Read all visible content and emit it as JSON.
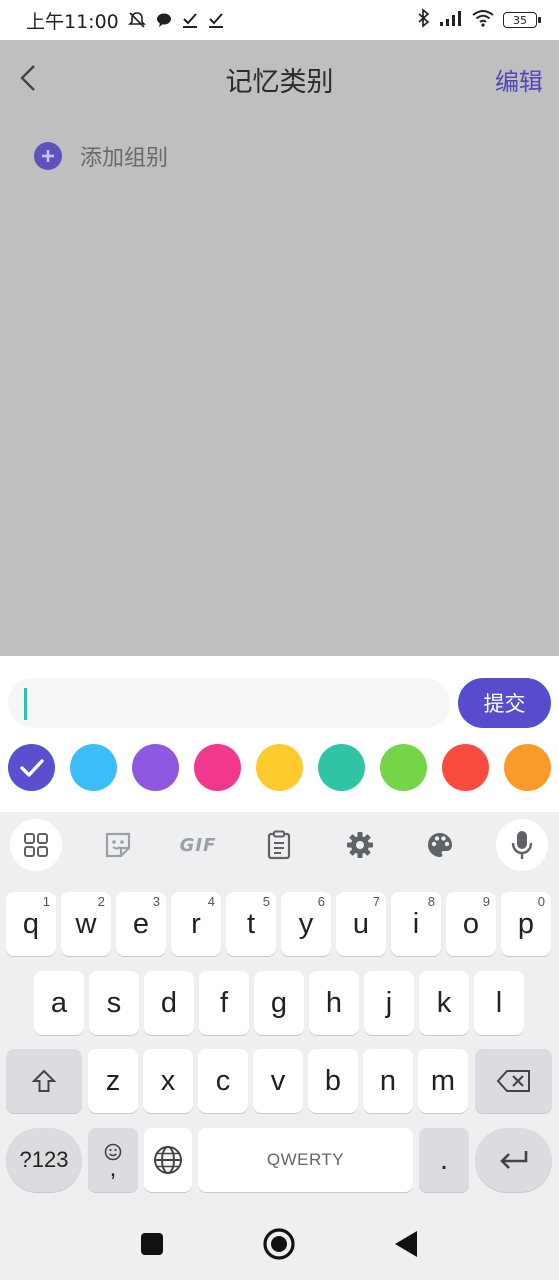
{
  "status_bar": {
    "time": "上午11:00",
    "battery": "35",
    "icons": [
      "mute-bell-icon",
      "chat-bubble-icon",
      "check-icon",
      "check-icon",
      "bluetooth-icon",
      "signal-icon",
      "wifi-icon",
      "battery-icon"
    ]
  },
  "header": {
    "back_icon": "chevron-left-icon",
    "title": "记忆类别",
    "edit_label": "编辑"
  },
  "content": {
    "add_group_icon": "plus-circle-icon",
    "add_group_label": "添加组别"
  },
  "input_panel": {
    "value": "",
    "submit_label": "提交",
    "selected_color": "#5a4fcf",
    "colors": [
      "#5a4fcf",
      "#3cbcf9",
      "#8f58e0",
      "#f2388c",
      "#fdcc2c",
      "#2fc4a4",
      "#75d548",
      "#f94b3f",
      "#f99a2a"
    ]
  },
  "keyboard": {
    "toolbar": [
      "apps-grid-icon",
      "sticker-icon",
      "GIF",
      "clipboard-icon",
      "gear-icon",
      "palette-icon",
      "microphone-icon"
    ],
    "row1": [
      {
        "k": "q",
        "h": "1"
      },
      {
        "k": "w",
        "h": "2"
      },
      {
        "k": "e",
        "h": "3"
      },
      {
        "k": "r",
        "h": "4"
      },
      {
        "k": "t",
        "h": "5"
      },
      {
        "k": "y",
        "h": "6"
      },
      {
        "k": "u",
        "h": "7"
      },
      {
        "k": "i",
        "h": "8"
      },
      {
        "k": "o",
        "h": "9"
      },
      {
        "k": "p",
        "h": "0"
      }
    ],
    "row2": [
      "a",
      "s",
      "d",
      "f",
      "g",
      "h",
      "j",
      "k",
      "l"
    ],
    "row3": [
      "z",
      "x",
      "c",
      "v",
      "b",
      "n",
      "m"
    ],
    "symbols_label": "?123",
    "comma_label": ",",
    "space_label": "QWERTY",
    "period_label": "."
  },
  "system_nav": [
    "recents-square-icon",
    "home-circle-icon",
    "back-triangle-icon"
  ]
}
